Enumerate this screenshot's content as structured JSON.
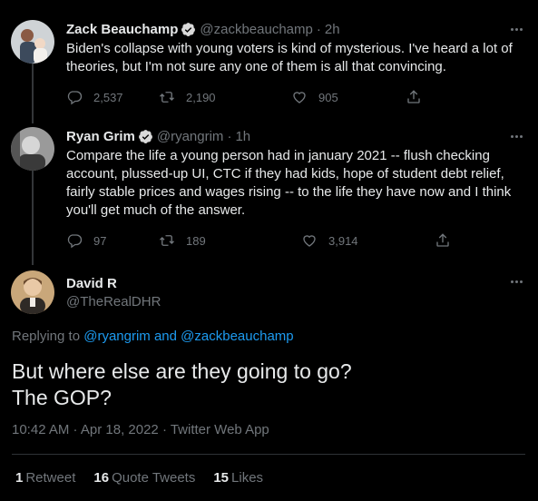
{
  "tweets": [
    {
      "name": "Zack Beauchamp",
      "handle": "@zackbeauchamp",
      "time": "2h",
      "text": "Biden's collapse with young voters is kind of mysterious. I've heard a lot of theories, but I'm not sure any one of them is all that convincing.",
      "replies": "2,537",
      "retweets": "2,190",
      "likes": "905"
    },
    {
      "name": "Ryan Grim",
      "handle": "@ryangrim",
      "time": "1h",
      "text": "Compare the life a young person had in january 2021 -- flush checking account, plussed-up UI, CTC if they had kids, hope of student debt relief, fairly stable prices and wages rising -- to the life they have now and I think you'll get much of the answer.",
      "replies": "97",
      "retweets": "189",
      "likes": "3,914"
    }
  ],
  "main": {
    "name": "David R",
    "handle": "@TheRealDHR",
    "replying_prefix": "Replying to",
    "replying_to_1": "@ryangrim",
    "replying_and": "and",
    "replying_to_2": "@zackbeauchamp",
    "text_line1": "But where else are they going to go?",
    "text_line2": "The GOP?",
    "timestamp": "10:42 AM · Apr 18, 2022 · Twitter Web App",
    "stats": {
      "retweets_count": "1",
      "retweets_label": "Retweet",
      "quotes_count": "16",
      "quotes_label": "Quote Tweets",
      "likes_count": "15",
      "likes_label": "Likes"
    }
  },
  "colors": {
    "background": "#000000",
    "text": "#e7e9ea",
    "secondary": "#71767b",
    "link": "#1d9bf0",
    "verified": "#1d9bf0"
  }
}
